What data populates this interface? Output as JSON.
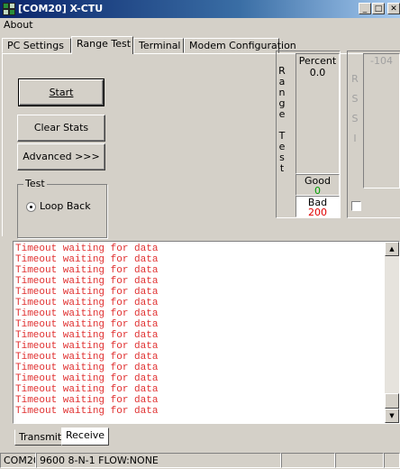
{
  "window": {
    "title": "[COM20] X-CTU",
    "minimize_glyph": "_",
    "maximize_glyph": "□",
    "close_glyph": "✕"
  },
  "menu": {
    "items": [
      "About"
    ]
  },
  "tabs": [
    "PC Settings",
    "Range Test",
    "Terminal",
    "Modem Configuration"
  ],
  "active_tab": "Range Test",
  "range_test": {
    "start_button": "Start",
    "clear_stats_button": "Clear Stats",
    "advanced_button": "Advanced >>>",
    "test_group_label": "Test",
    "loop_back_label": "Loop Back",
    "loop_back_selected": true,
    "vertical_label": [
      "R",
      "a",
      "n",
      "g",
      "e",
      "",
      "T",
      "e",
      "s",
      "t"
    ],
    "percent_label": "Percent",
    "percent_value": "0.0",
    "good_label": "Good",
    "good_value": "0",
    "good_color": "#00a000",
    "bad_label": "Bad",
    "bad_value": "200",
    "bad_color": "#e00000",
    "rssi_label": [
      "R",
      "S",
      "S",
      "I"
    ],
    "rssi_value": "-104",
    "rssi_checkbox_checked": false
  },
  "log": {
    "color": "#e03030",
    "lines": [
      "Timeout waiting for data",
      "Timeout waiting for data",
      "Timeout waiting for data",
      "Timeout waiting for data",
      "Timeout waiting for data",
      "Timeout waiting for data",
      "Timeout waiting for data",
      "Timeout waiting for data",
      "Timeout waiting for data",
      "Timeout waiting for data",
      "Timeout waiting for data",
      "Timeout waiting for data",
      "Timeout waiting for data",
      "Timeout waiting for data",
      "Timeout waiting for data",
      "Timeout waiting for data"
    ]
  },
  "bottom_tabs": [
    "Transmit",
    "Receive"
  ],
  "active_bottom_tab": "Receive",
  "status": {
    "port": "COM20",
    "settings": "9600 8-N-1  FLOW:NONE"
  }
}
